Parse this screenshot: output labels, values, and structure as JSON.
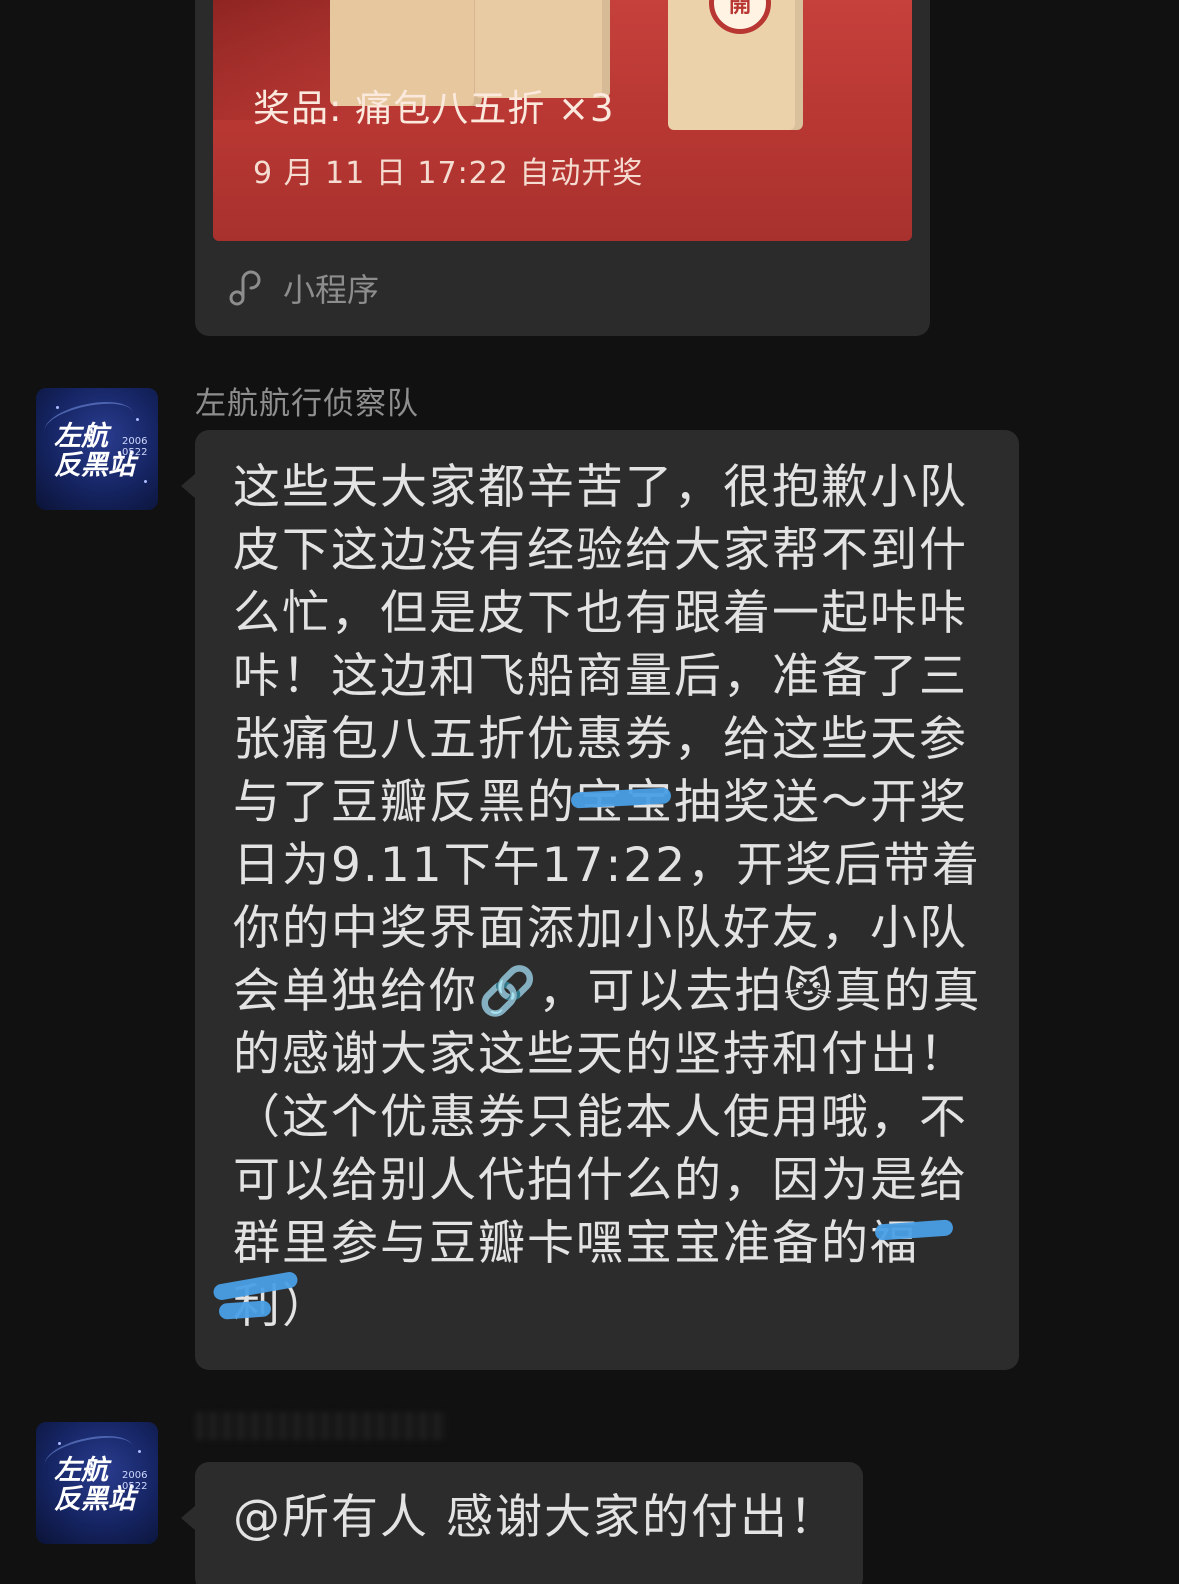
{
  "mini_program_card": {
    "badge": "開",
    "prize": "奖品: 痛包八五折  ×3",
    "draw_time": "9 月 11 日 17:22 自动开奖",
    "footer_icon": "link-icon",
    "footer_label": "小程序",
    "banner_color": "#c0403b"
  },
  "messages": [
    {
      "sender": "左航航行侦察队",
      "avatar_text": "左航\n反黑站",
      "avatar_num": "2006\n0522",
      "text": "这些天大家都辛苦了，很抱歉小队皮下这边没有经验给大家帮不到什么忙，但是皮下也有跟着一起咔咔咔！这边和飞船商量后，准备了三张痛包八五折优惠券，给这些天参与了豆瓣反黑的宝宝抽奖送～开奖日为9.11下午17:22，开奖后带着你的中奖界面添加小队好友，小队会单独给你🔗，可以去拍😼真的真的感谢大家这些天的坚持和付出！（这个优惠券只能本人使用哦，不可以给别人代拍什么的，因为是给群里参与豆瓣卡嘿宝宝准备的福利）"
    },
    {
      "sender": "",
      "avatar_text": "左航\n反黑站",
      "avatar_num": "2006\n0522",
      "text": "@所有人 感谢大家的付出！"
    }
  ],
  "colors": {
    "background": "#111111",
    "bubble": "#2c2c2c",
    "redaction": "#4a9ee6"
  }
}
